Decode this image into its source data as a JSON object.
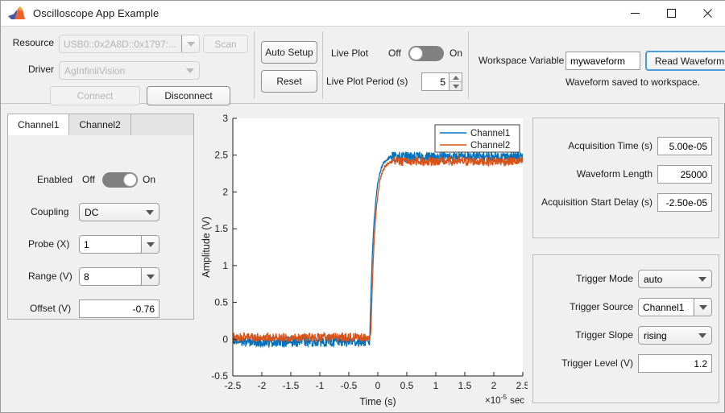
{
  "window": {
    "title": "Oscilloscope App Example",
    "icon": "matlab-membrane-icon",
    "minimize": "—",
    "maximize": "□",
    "close": "✕"
  },
  "toolbar": {
    "connection": {
      "resource_label": "Resource",
      "resource_value": "USB0::0x2A8D::0x1797:...",
      "scan_label": "Scan",
      "driver_label": "Driver",
      "driver_value": "AgInfiniiVision",
      "connect_label": "Connect",
      "disconnect_label": "Disconnect"
    },
    "actions": {
      "auto_setup_label": "Auto Setup",
      "reset_label": "Reset"
    },
    "liveplot": {
      "live_plot_label": "Live Plot",
      "off_label": "Off",
      "on_label": "On",
      "toggle_state": "off",
      "period_label": "Live Plot Period (s)",
      "period_value": "5"
    },
    "workspace": {
      "variable_label": "Workspace Variable",
      "variable_value": "mywaveform",
      "read_button_label": "Read Waveform",
      "status_text": "Waveform saved to workspace."
    }
  },
  "channel_panel": {
    "tabs": [
      {
        "label": "Channel1",
        "active": true
      },
      {
        "label": "Channel2",
        "active": false
      }
    ],
    "enabled_label": "Enabled",
    "enabled_off": "Off",
    "enabled_on": "On",
    "enabled_state": "on",
    "coupling_label": "Coupling",
    "coupling_value": "DC",
    "probe_label": "Probe (X)",
    "probe_value": "1",
    "range_label": "Range (V)",
    "range_value": "8",
    "offset_label": "Offset (V)",
    "offset_value": "-0.76"
  },
  "acquisition_panel": {
    "acq_time_label": "Acquisition Time (s)",
    "acq_time_value": "5.00e-05",
    "waveform_length_label": "Waveform Length",
    "waveform_length_value": "25000",
    "start_delay_label": "Acquisition Start Delay (s)",
    "start_delay_value": "-2.50e-05"
  },
  "trigger_panel": {
    "mode_label": "Trigger Mode",
    "mode_value": "auto",
    "source_label": "Trigger Source",
    "source_value": "Channel1",
    "slope_label": "Trigger Slope",
    "slope_value": "rising",
    "level_label": "Trigger Level (V)",
    "level_value": "1.2"
  },
  "chart_data": {
    "type": "line",
    "title": "",
    "xlabel": "Time (s)",
    "ylabel": "Amplitude (V)",
    "x_exponent_label": "×10",
    "x_exponent_sup": "-5",
    "x_exponent_unit": "sec",
    "xlim": [
      -2.5,
      2.5
    ],
    "ylim": [
      -0.5,
      3
    ],
    "xticks": [
      -2.5,
      -2,
      -1.5,
      -1,
      -0.5,
      0,
      0.5,
      1,
      1.5,
      2,
      2.5
    ],
    "xticklabels": [
      "-2.5",
      "-2",
      "-1.5",
      "-1",
      "-0.5",
      "0",
      "0.5",
      "1",
      "1.5",
      "2",
      "2.5"
    ],
    "yticks": [
      -0.5,
      0,
      0.5,
      1,
      1.5,
      2,
      2.5,
      3
    ],
    "yticklabels": [
      "-0.5",
      "0",
      "0.5",
      "1",
      "1.5",
      "2",
      "2.5",
      "3"
    ],
    "grid": false,
    "legend_position": "top-right",
    "series": [
      {
        "name": "Channel1",
        "color": "#0072BD",
        "baseline": 0.02,
        "top": 2.41,
        "noise": 0.06,
        "edge_start": -0.12,
        "edge_end": 0.26
      },
      {
        "name": "Channel2",
        "color": "#D95319",
        "baseline": -0.04,
        "top": 2.47,
        "noise": 0.07,
        "edge_start": -0.14,
        "edge_end": 0.24
      }
    ]
  }
}
